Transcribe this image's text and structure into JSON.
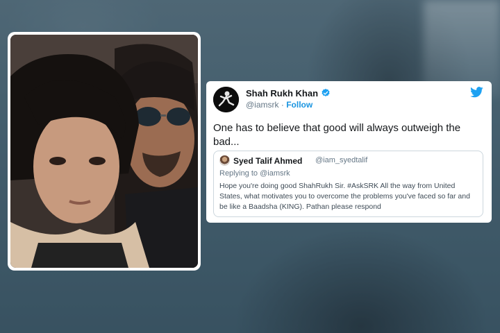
{
  "tweet": {
    "author_name": "Shah Rukh Khan",
    "handle": "@iamsrk",
    "separator": "·",
    "follow_label": "Follow",
    "text": "One has to believe that good will always outweigh the bad...",
    "icons": {
      "verified": "verified-badge-icon",
      "brand": "twitter-bird-icon"
    },
    "quoted": {
      "author_name": "Syed Talif Ahmed",
      "handle": "@iam_syedtalif",
      "replying_to": "Replying to @iamsrk",
      "text": "Hope you're doing good ShahRukh Sir. #AskSRK All the way from United States, what motivates you to overcome the problems you've faced so far and be like a Baadsha (KING). Pathan please respond"
    }
  },
  "colors": {
    "accent": "#1DA1F2",
    "follow_link": "#1b95e0",
    "card_background": "#ffffff",
    "page_background": "#3f5866"
  }
}
